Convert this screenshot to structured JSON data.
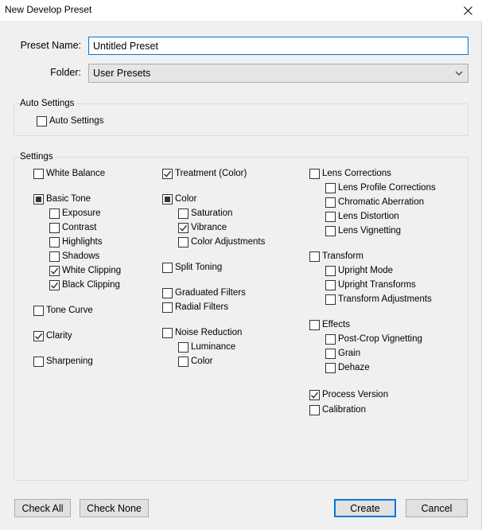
{
  "window": {
    "title": "New Develop Preset"
  },
  "preset_name": {
    "label": "Preset Name:",
    "value": "Untitled Preset"
  },
  "folder": {
    "label": "Folder:",
    "selected": "User Presets"
  },
  "auto_settings": {
    "group_label": "Auto Settings",
    "checkbox": {
      "label": "Auto Settings",
      "state": "unchecked"
    }
  },
  "settings": {
    "group_label": "Settings",
    "col1": [
      {
        "label": "White Balance",
        "state": "unchecked"
      },
      {
        "label": "Basic Tone",
        "state": "partial"
      },
      {
        "label": "Exposure",
        "state": "unchecked"
      },
      {
        "label": "Contrast",
        "state": "unchecked"
      },
      {
        "label": "Highlights",
        "state": "unchecked"
      },
      {
        "label": "Shadows",
        "state": "unchecked"
      },
      {
        "label": "White Clipping",
        "state": "checked"
      },
      {
        "label": "Black Clipping",
        "state": "checked"
      },
      {
        "label": "Tone Curve",
        "state": "unchecked"
      },
      {
        "label": "Clarity",
        "state": "checked"
      },
      {
        "label": "Sharpening",
        "state": "unchecked"
      }
    ],
    "col2": [
      {
        "label": "Treatment (Color)",
        "state": "checked"
      },
      {
        "label": "Color",
        "state": "partial"
      },
      {
        "label": "Saturation",
        "state": "unchecked"
      },
      {
        "label": "Vibrance",
        "state": "checked"
      },
      {
        "label": "Color Adjustments",
        "state": "unchecked"
      },
      {
        "label": "Split Toning",
        "state": "unchecked"
      },
      {
        "label": "Graduated Filters",
        "state": "unchecked"
      },
      {
        "label": "Radial Filters",
        "state": "unchecked"
      },
      {
        "label": "Noise Reduction",
        "state": "unchecked"
      },
      {
        "label": "Luminance",
        "state": "unchecked"
      },
      {
        "label": "Color",
        "state": "unchecked"
      }
    ],
    "col3": [
      {
        "label": "Lens Corrections",
        "state": "unchecked"
      },
      {
        "label": "Lens Profile Corrections",
        "state": "unchecked"
      },
      {
        "label": "Chromatic Aberration",
        "state": "unchecked"
      },
      {
        "label": "Lens Distortion",
        "state": "unchecked"
      },
      {
        "label": "Lens Vignetting",
        "state": "unchecked"
      },
      {
        "label": "Transform",
        "state": "unchecked"
      },
      {
        "label": "Upright Mode",
        "state": "unchecked"
      },
      {
        "label": "Upright Transforms",
        "state": "unchecked"
      },
      {
        "label": "Transform Adjustments",
        "state": "unchecked"
      },
      {
        "label": "Effects",
        "state": "unchecked"
      },
      {
        "label": "Post-Crop Vignetting",
        "state": "unchecked"
      },
      {
        "label": "Grain",
        "state": "unchecked"
      },
      {
        "label": "Dehaze",
        "state": "unchecked"
      },
      {
        "label": "Process Version",
        "state": "checked"
      },
      {
        "label": "Calibration",
        "state": "unchecked"
      }
    ]
  },
  "buttons": {
    "check_all": "Check All",
    "check_none": "Check None",
    "create": "Create",
    "cancel": "Cancel"
  },
  "colors": {
    "accent": "#0078d7",
    "dialog_bg": "#f0f0f0",
    "button_bg": "#e1e1e1"
  }
}
